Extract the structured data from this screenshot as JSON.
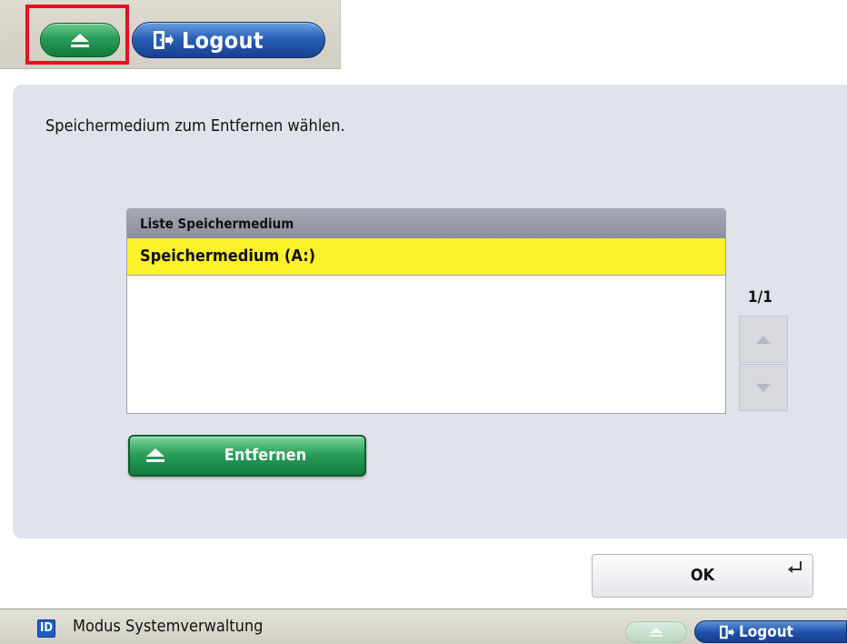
{
  "toolbar": {
    "eject_icon": "eject-icon",
    "logout_label": "Logout",
    "logout_icon": "door-exit-icon",
    "highlight_color": "#e3141d"
  },
  "main": {
    "instruction": "Speichermedium zum Entfernen wählen.",
    "list": {
      "header": "Liste Speichermedium",
      "items": [
        {
          "label": "Speichermedium (A:)",
          "selected": true
        }
      ]
    },
    "page_indicator": "1/1",
    "remove_button_label": "Entfernen"
  },
  "footer": {
    "ok_label": "OK"
  },
  "status_bar": {
    "id_badge": "ID",
    "mode_text": "Modus Systemverwaltung",
    "logout_label": "Logout"
  },
  "colors": {
    "selected_row": "#fdf12a",
    "green_button": "#2aa05a",
    "blue_button": "#2960b8",
    "panel_bg": "#e1e3eb"
  }
}
